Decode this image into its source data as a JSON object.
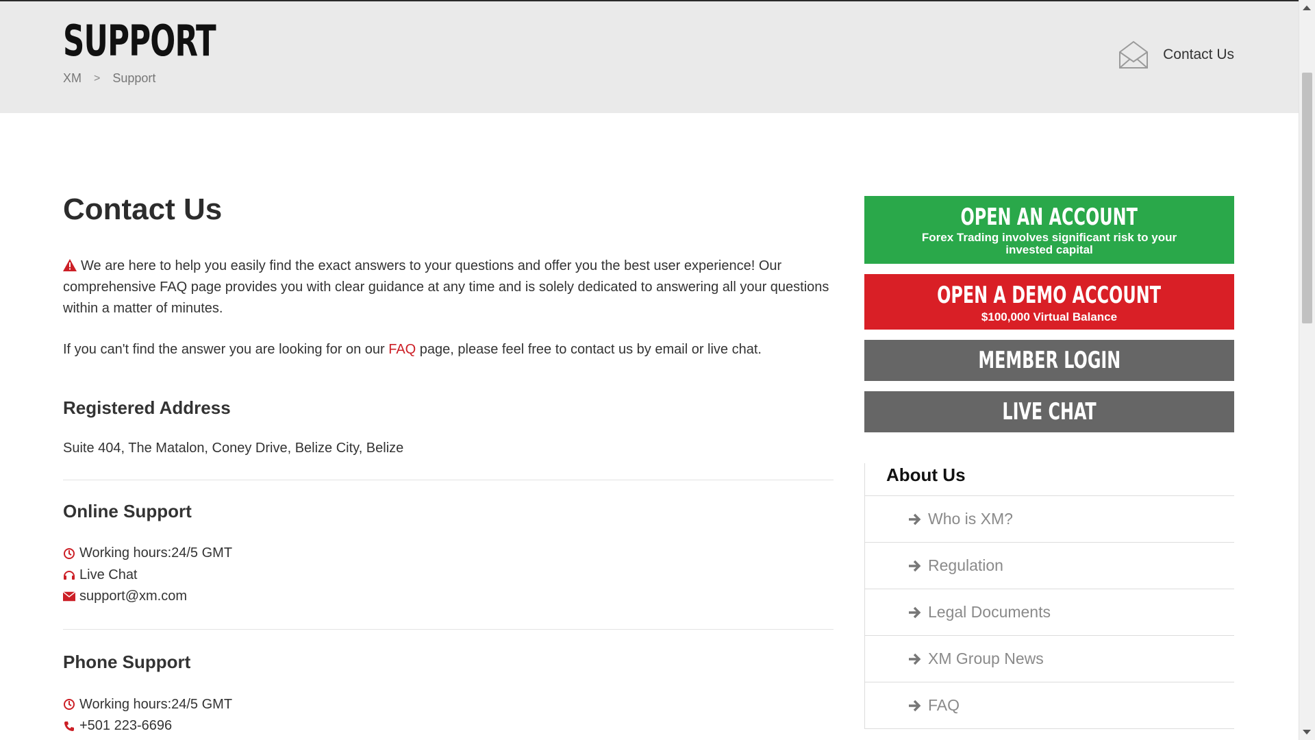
{
  "header": {
    "title": "SUPPORT",
    "breadcrumb": [
      "XM",
      "Support"
    ],
    "breadcrumb_separator": ">",
    "contact_label": "Contact Us"
  },
  "main": {
    "heading": "Contact Us",
    "intro": "We are here to help you easily find the exact answers to your questions and offer you the best user experience! Our comprehensive FAQ page provides you with clear guidance at any time and is solely dedicated to answering all your questions within a matter of minutes.",
    "faq_before": "If you can't find the answer you are looking for on our ",
    "faq_link": "FAQ",
    "faq_after": " page, please feel free to contact us by email or live chat.",
    "registered_address": {
      "title": "Registered Address",
      "text": "Suite 404, The Matalon, Coney Drive, Belize City, Belize"
    },
    "online_support": {
      "title": "Online Support",
      "hours": "Working hours:24/5 GMT",
      "live_chat": "Live Chat",
      "email": "support@xm.com"
    },
    "phone_support": {
      "title": "Phone Support",
      "hours": "Working hours:24/5 GMT",
      "phone": "+501 223-6696"
    }
  },
  "sidebar": {
    "open_account": {
      "label": "OPEN AN ACCOUNT",
      "sub": "Forex Trading involves significant risk to your invested capital"
    },
    "open_demo": {
      "label": "OPEN A DEMO ACCOUNT",
      "sub": "$100,000 Virtual Balance"
    },
    "member_login": "MEMBER LOGIN",
    "live_chat": "LIVE CHAT",
    "about": {
      "title": "About Us",
      "items": [
        "Who is XM?",
        "Regulation",
        "Legal Documents",
        "XM Group News",
        "FAQ"
      ]
    }
  },
  "colors": {
    "accent_red": "#cc1f26",
    "green": "#2aa84a",
    "demo_red": "#d91f26",
    "grey_button": "#666666",
    "header_band": "#eaeaea"
  },
  "icons": {
    "warning": "warning-icon",
    "clock": "clock-icon",
    "headset": "headset-icon",
    "envelope": "envelope-icon",
    "phone": "phone-icon",
    "arrow": "arrow-right-icon",
    "mail_outline": "mail-outline-icon"
  }
}
